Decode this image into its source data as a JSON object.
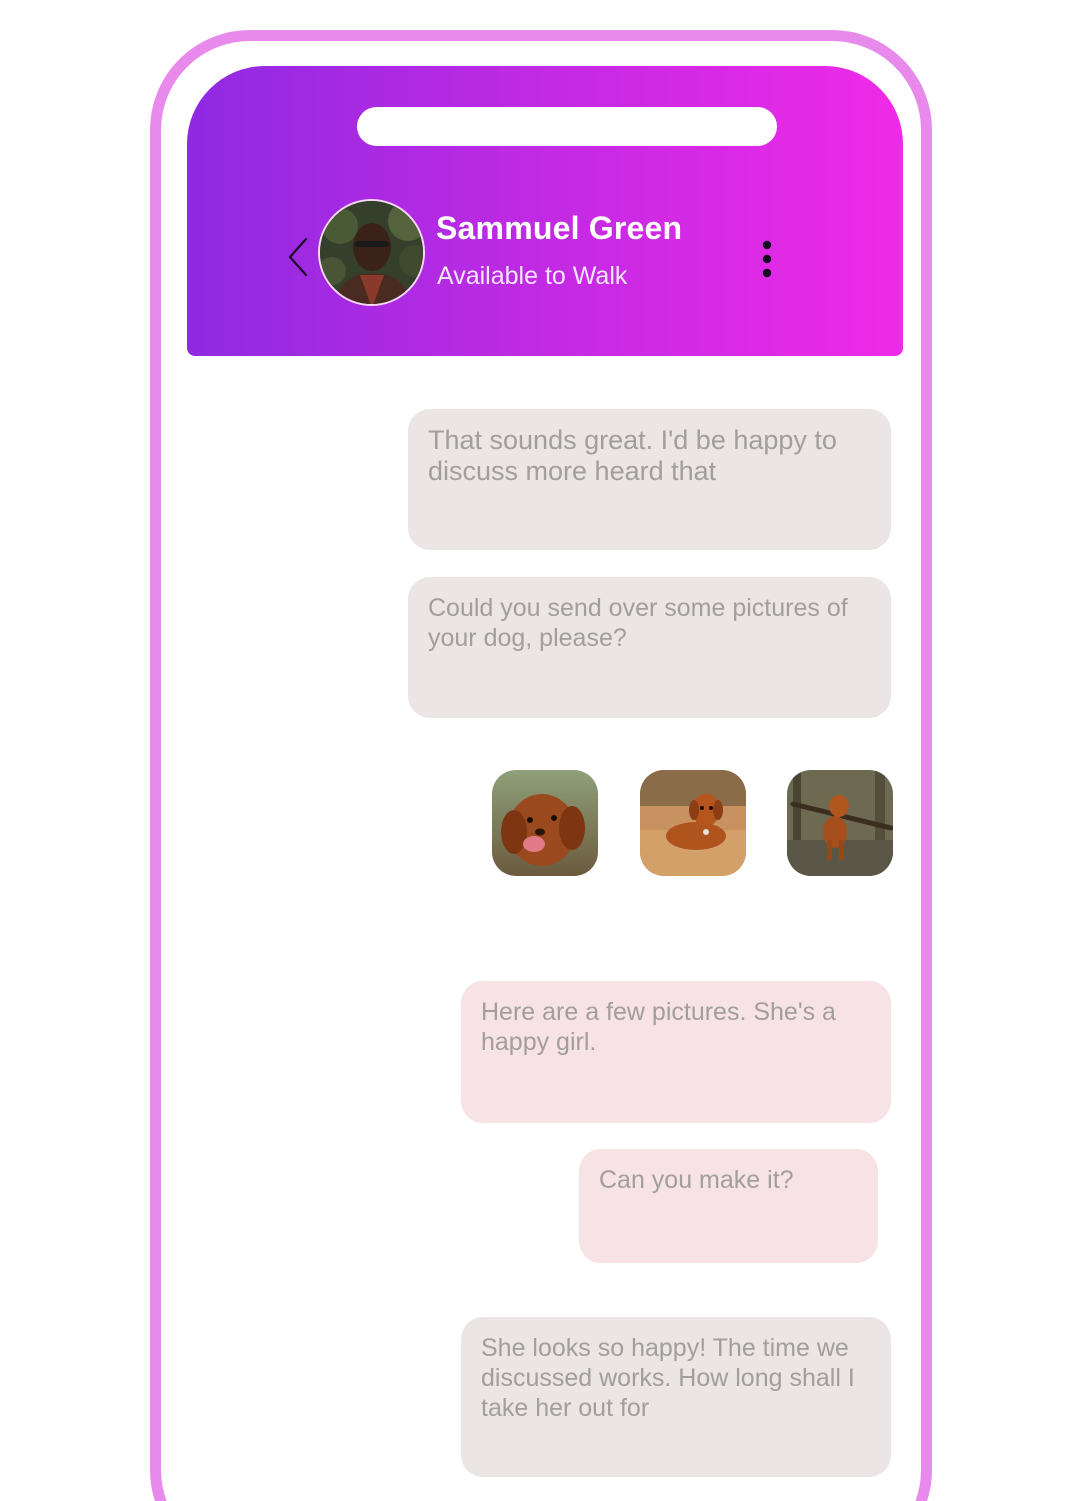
{
  "header": {
    "contact_name": "Sammuel Green",
    "contact_status": "Available to Walk",
    "back_icon": "chevron-left-icon",
    "more_icon": "more-vertical-icon",
    "gradient_start": "#8e2ae2",
    "gradient_end": "#ef2ae8"
  },
  "messages": [
    {
      "direction": "received",
      "text": "That sounds great. I'd be happy to discuss more heard that"
    },
    {
      "direction": "received",
      "text": "Could you send over some pictures of your dog, please?"
    },
    {
      "direction": "sent",
      "text": "Here are a few pictures. She's a happy girl."
    },
    {
      "direction": "sent",
      "text": "Can you make it?"
    },
    {
      "direction": "received",
      "text": "She looks so happy! The time we discussed works. How long shall I take her out for"
    }
  ],
  "photos": [
    {
      "name": "dog-photo-1"
    },
    {
      "name": "dog-photo-2"
    },
    {
      "name": "dog-photo-3"
    }
  ],
  "colors": {
    "frame": "#e889ec",
    "received_bubble": "#ebe5e5",
    "sent_bubble": "#f7e2e5",
    "bubble_text": "#a29e9e"
  }
}
